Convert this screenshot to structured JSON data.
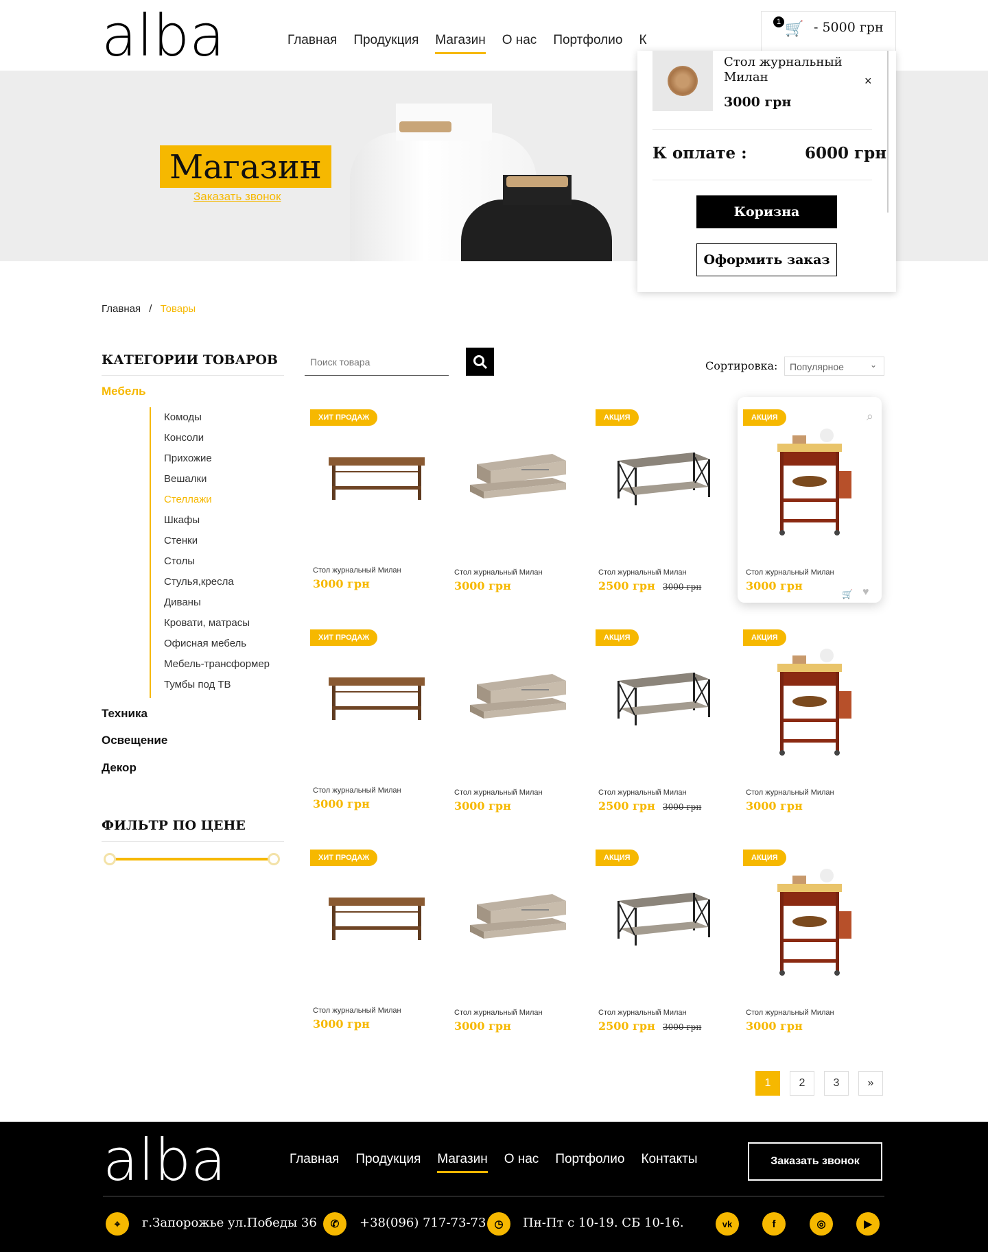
{
  "brand": {
    "logo": "alba",
    "accent": "#f6b800"
  },
  "nav": {
    "items": [
      "Главная",
      "Продукция",
      "Магазин",
      "О нас",
      "Портфолио",
      "К"
    ],
    "active": "Магазин"
  },
  "cart": {
    "count": "1",
    "total_label": "- 5000 грн",
    "item": {
      "name": "Стол журнальный Милан",
      "price": "3000 грн"
    },
    "remove_icon": "×",
    "pay_label": "К оплате :",
    "pay_total": "6000 грн",
    "cart_button": "Коризна",
    "checkout_button": "Оформить заказ"
  },
  "hero": {
    "title": "Магазин",
    "link": "Заказать звонок"
  },
  "breadcrumb": {
    "home": "Главная",
    "separator": "/",
    "current": "Товары"
  },
  "sidebar": {
    "categories_title": "КАТЕГОРИИ ТОВАРОВ",
    "main_active": "Мебель",
    "items": [
      "Комоды",
      "Консоли",
      "Прихожие",
      "Вешалки",
      "Стеллажи",
      "Шкафы",
      "Стенки",
      "Столы",
      "Стулья,кресла",
      "Диваны",
      "Кровати, матрасы",
      "Офисная мебель",
      "Мебель-трансформер",
      "Тумбы под ТВ"
    ],
    "active_item": "Стеллажи",
    "other": [
      "Техника",
      "Освещение",
      "Декор"
    ],
    "price_filter_title": "ФИЛЬТР ПО ЦЕНЕ"
  },
  "search": {
    "placeholder": "Поиск товара"
  },
  "sort": {
    "label": "Сортировка:",
    "value": "Популярное"
  },
  "products": [
    {
      "badge": "ХИТ ПРОДАЖ",
      "name": "Стол журнальный Милан",
      "price": "3000 грн",
      "old": "",
      "img": "wood-table"
    },
    {
      "badge": "",
      "name": "Стол журнальный Милан",
      "price": "3000 грн",
      "old": "",
      "img": "grey-table"
    },
    {
      "badge": "АКЦИЯ",
      "name": "Стол журнальный Милан",
      "price": "2500 грн",
      "old": "3000 грн",
      "img": "metal-table"
    },
    {
      "badge": "АКЦИЯ",
      "name": "Стол журнальный Милан",
      "price": "3000 грн",
      "old": "",
      "img": "kitchen-cart"
    },
    {
      "badge": "ХИТ ПРОДАЖ",
      "name": "Стол журнальный Милан",
      "price": "3000 грн",
      "old": "",
      "img": "wood-table"
    },
    {
      "badge": "",
      "name": "Стол журнальный Милан",
      "price": "3000 грн",
      "old": "",
      "img": "grey-table"
    },
    {
      "badge": "АКЦИЯ",
      "name": "Стол журнальный Милан",
      "price": "2500 грн",
      "old": "3000 грн",
      "img": "metal-table"
    },
    {
      "badge": "АКЦИЯ",
      "name": "Стол журнальный Милан",
      "price": "3000 грн",
      "old": "",
      "img": "kitchen-cart"
    },
    {
      "badge": "ХИТ ПРОДАЖ",
      "name": "Стол журнальный Милан",
      "price": "3000 грн",
      "old": "",
      "img": "wood-table"
    },
    {
      "badge": "",
      "name": "Стол журнальный Милан",
      "price": "3000 грн",
      "old": "",
      "img": "grey-table"
    },
    {
      "badge": "АКЦИЯ",
      "name": "Стол журнальный Милан",
      "price": "2500 грн",
      "old": "3000 грн",
      "img": "metal-table"
    },
    {
      "badge": "АКЦИЯ",
      "name": "Стол журнальный Милан",
      "price": "3000 грн",
      "old": "",
      "img": "kitchen-cart"
    }
  ],
  "pagination": {
    "pages": [
      "1",
      "2",
      "3"
    ],
    "active": "1",
    "next": "»"
  },
  "footer": {
    "nav": [
      "Главная",
      "Продукция",
      "Магазин",
      "О нас",
      "Портфолио",
      "Контакты"
    ],
    "active": "Магазин",
    "callback_button": "Заказать звонок",
    "address": "г.Запорожье ул.Победы 36",
    "phone": "+38(096) 717-73-73",
    "hours": "Пн-Пт с 10-19. СБ 10-16.",
    "socials": [
      "vk-icon",
      "facebook-icon",
      "instagram-icon",
      "youtube-icon"
    ]
  }
}
